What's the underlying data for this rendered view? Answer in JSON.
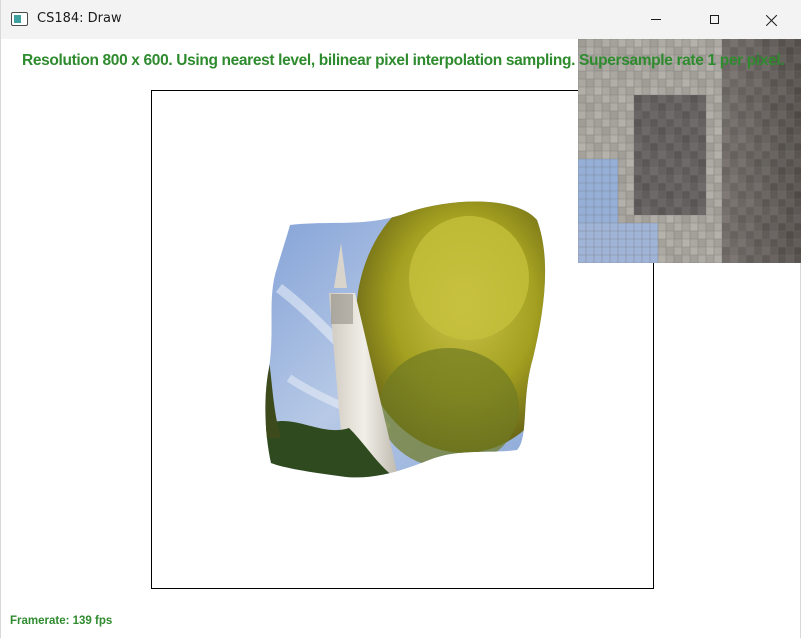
{
  "window": {
    "title": "CS184: Draw",
    "icons": {
      "app": "app-window-icon",
      "minimize": "minimize-icon",
      "maximize": "maximize-icon",
      "close": "close-icon"
    }
  },
  "overlay": {
    "status": "Resolution 800 x 600. Using nearest level, bilinear pixel interpolation sampling. Supersample rate 1 per pixel.",
    "framerate": "Framerate: 139 fps"
  },
  "colors": {
    "overlay_text": "#2e8b2e",
    "titlebar": "#f3f3f3",
    "frame_border": "#000000",
    "sky": "#9fb7dc",
    "foliage": "#b2ad2a",
    "tower": "#e7e4dc"
  },
  "image": {
    "subject": "clock tower with trees under blue sky, warped",
    "zoom_subject": "magnified pixel grid of tower stonework"
  }
}
